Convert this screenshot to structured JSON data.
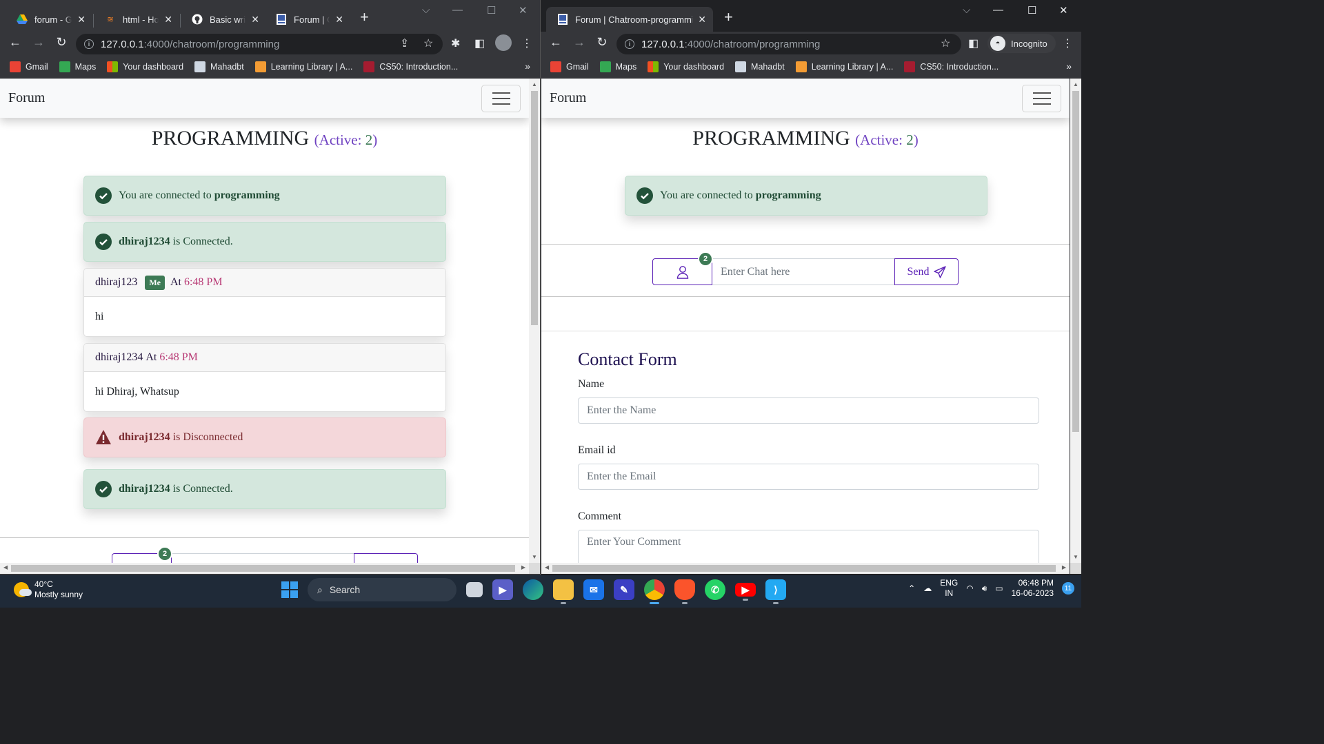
{
  "left_window": {
    "tabs": [
      {
        "title": "forum - Google Drive",
        "visible_title": "forum - Go",
        "icon": "google-drive-icon"
      },
      {
        "title": "html - How",
        "visible_title": "html - How",
        "icon": "stackoverflow-icon"
      },
      {
        "title": "Basic writing",
        "visible_title": "Basic writin",
        "icon": "github-icon"
      },
      {
        "title": "Forum | Chatroom-programming",
        "visible_title": "Forum | Ch",
        "icon": "forum-favicon",
        "active": true
      }
    ],
    "url_host": "127.0.0.1",
    "url_path": ":4000/chatroom/programming"
  },
  "right_window": {
    "tabs": [
      {
        "title": "Forum | Chatroom-programming",
        "visible_title": "Forum | Chatroom-programming",
        "icon": "forum-favicon",
        "active": true
      }
    ],
    "url_host": "127.0.0.1",
    "url_path": ":4000/chatroom/programming",
    "incognito_label": "Incognito"
  },
  "bookmarks": [
    {
      "label": "Gmail",
      "color": "#ea4335"
    },
    {
      "label": "Maps",
      "color": "#34a853"
    },
    {
      "label": "Your dashboard",
      "color": "#f25022"
    },
    {
      "label": "Mahadbt",
      "color": "#cfd8e3"
    },
    {
      "label": "Learning Library | A...",
      "color": "#f39c34"
    },
    {
      "label": "CS50: Introduction...",
      "color": "#a51c30"
    }
  ],
  "bookmarks_more": "»",
  "page": {
    "brand": "Forum",
    "room_name": "PROGRAMMING",
    "active_label": "(Active: ",
    "active_count": "2",
    "active_close": ")"
  },
  "left_feed": {
    "connected_alert": {
      "prefix": "You are connected to ",
      "room": "programming"
    },
    "user_connected_1": {
      "user": "dhiraj1234",
      "text": " is Connected."
    },
    "message_1": {
      "user": "dhiraj123",
      "badge": "Me",
      "at": "At",
      "time": "6:48 PM",
      "body": "hi"
    },
    "message_2": {
      "user": "dhiraj1234",
      "at": "At",
      "time": "6:48 PM",
      "body": "hi Dhiraj, Whatsup"
    },
    "user_disconnected": {
      "user": "dhiraj1234",
      "text": " is Disconnected"
    },
    "user_connected_2": {
      "user": "dhiraj1234",
      "text": " is Connected."
    },
    "online_count": "2"
  },
  "right_feed": {
    "connected_alert": {
      "prefix": "You are connected to ",
      "room": "programming"
    },
    "online_count": "2",
    "chat_placeholder": "Enter Chat here",
    "send_label": "Send"
  },
  "contact_form": {
    "title": "Contact Form",
    "name_label": "Name",
    "name_placeholder": "Enter the Name",
    "email_label": "Email id",
    "email_placeholder": "Enter the Email",
    "comment_label": "Comment",
    "comment_placeholder": "Enter Your Comment"
  },
  "taskbar": {
    "temperature": "40°C",
    "weather": "Mostly sunny",
    "search_label": "Search",
    "lang_line1": "ENG",
    "lang_line2": "IN",
    "time": "06:48 PM",
    "date": "16-06-2023",
    "notification_count": "11"
  }
}
